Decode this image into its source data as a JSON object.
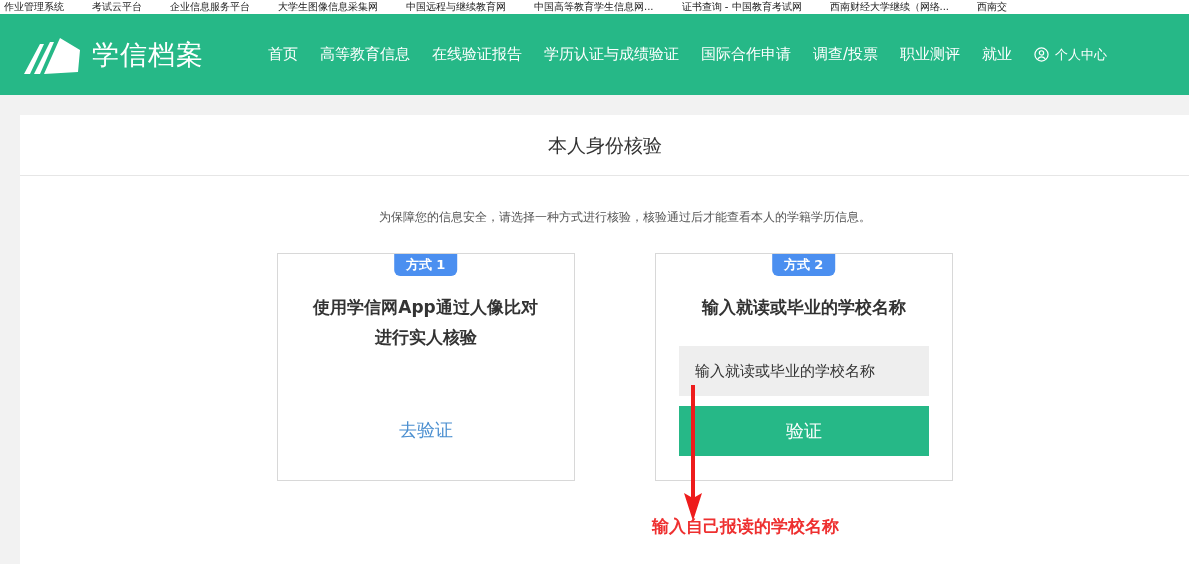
{
  "bookmarks": [
    "作业管理系统",
    "考试云平台",
    "企业信息服务平台",
    "大学生图像信息采集网",
    "中国远程与继续教育网",
    "中国高等教育学生信息网...",
    "证书查询 - 中国教育考试网",
    "西南财经大学继续（网络...",
    "西南交"
  ],
  "header": {
    "logo": "学信档案",
    "nav": [
      "首页",
      "高等教育信息",
      "在线验证报告",
      "学历认证与成绩验证",
      "国际合作申请",
      "调查/投票",
      "职业测评",
      "就业"
    ],
    "account": "个人中心"
  },
  "panel": {
    "title": "本人身份核验",
    "notice": "为保障您的信息安全，请选择一种方式进行核验，核验通过后才能查看本人的学籍学历信息。",
    "methods": [
      {
        "kind": "link",
        "badge": "方式 1",
        "heading": "使用学信网App通过人像比对进行实人核验",
        "link": "去验证"
      },
      {
        "kind": "form",
        "badge": "方式 2",
        "heading": "输入就读或毕业的学校名称",
        "placeholder": "输入就读或毕业的学校名称",
        "button": "验证"
      }
    ]
  },
  "annotation": "输入自己报读的学校名称"
}
